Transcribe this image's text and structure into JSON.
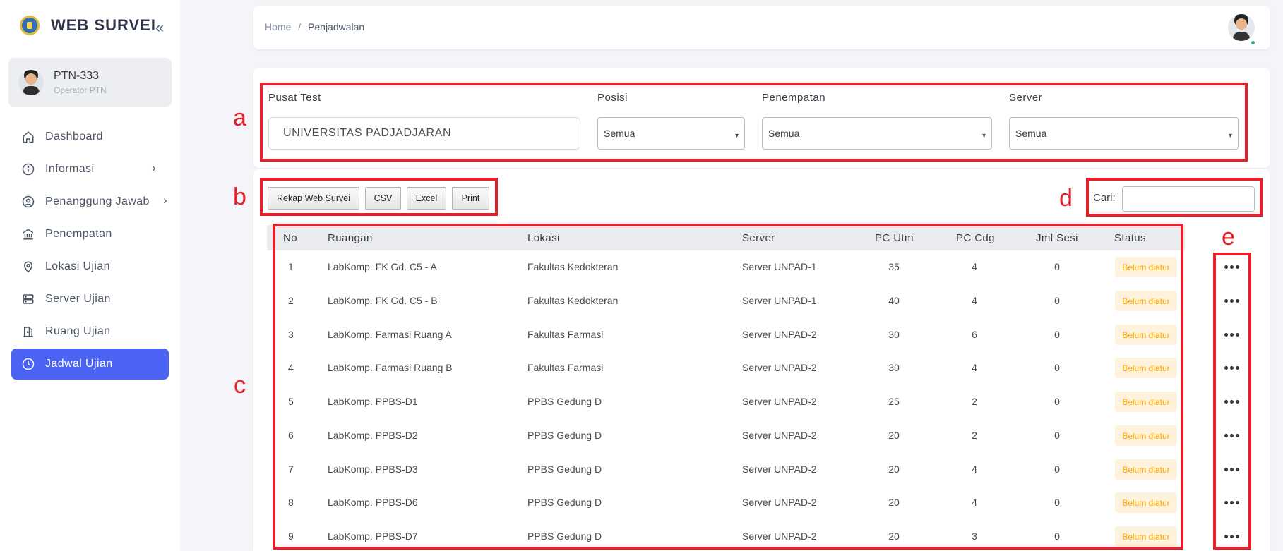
{
  "sidebar": {
    "brand_title": "WEB SURVEI",
    "user": {
      "name": "PTN-333",
      "role": "Operator PTN"
    },
    "items": [
      {
        "label": "Dashboard",
        "icon": "home-icon"
      },
      {
        "label": "Informasi",
        "icon": "info-icon",
        "has_children": true
      },
      {
        "label": "Penanggung Jawab",
        "icon": "user-circle-icon",
        "has_children": true
      },
      {
        "label": "Penempatan",
        "icon": "bank-icon"
      },
      {
        "label": "Lokasi Ujian",
        "icon": "map-pin-icon"
      },
      {
        "label": "Server Ujian",
        "icon": "server-icon"
      },
      {
        "label": "Ruang Ujian",
        "icon": "door-icon"
      },
      {
        "label": "Jadwal Ujian",
        "icon": "clock-icon",
        "active": true
      }
    ],
    "accent_color": "#4a63f2"
  },
  "header": {
    "breadcrumb_home": "Home",
    "breadcrumb_separator": "/",
    "breadcrumb_current": "Penjadwalan"
  },
  "filters": {
    "pusat_test": {
      "label": "Pusat Test",
      "value": "UNIVERSITAS PADJADJARAN"
    },
    "posisi": {
      "label": "Posisi",
      "value": "Semua"
    },
    "penempatan": {
      "label": "Penempatan",
      "value": "Semua"
    },
    "server": {
      "label": "Server",
      "value": "Semua"
    }
  },
  "toolbar": {
    "buttons": [
      "Rekap Web Survei",
      "CSV",
      "Excel",
      "Print"
    ],
    "search_label": "Cari:"
  },
  "table": {
    "headers": [
      "No",
      "Ruangan",
      "Lokasi",
      "Server",
      "PC Utm",
      "PC Cdg",
      "Jml Sesi",
      "Status"
    ],
    "rows": [
      {
        "no": "1",
        "ruangan": "LabKomp. FK Gd. C5 - A",
        "lokasi": "Fakultas Kedokteran",
        "server": "Server UNPAD-1",
        "pc_utm": "35",
        "pc_cdg": "4",
        "jml_sesi": "0",
        "status": "Belum diatur"
      },
      {
        "no": "2",
        "ruangan": "LabKomp. FK Gd. C5 - B",
        "lokasi": "Fakultas Kedokteran",
        "server": "Server UNPAD-1",
        "pc_utm": "40",
        "pc_cdg": "4",
        "jml_sesi": "0",
        "status": "Belum diatur"
      },
      {
        "no": "3",
        "ruangan": "LabKomp. Farmasi Ruang A",
        "lokasi": "Fakultas Farmasi",
        "server": "Server UNPAD-2",
        "pc_utm": "30",
        "pc_cdg": "6",
        "jml_sesi": "0",
        "status": "Belum diatur"
      },
      {
        "no": "4",
        "ruangan": "LabKomp. Farmasi Ruang B",
        "lokasi": "Fakultas Farmasi",
        "server": "Server UNPAD-2",
        "pc_utm": "30",
        "pc_cdg": "4",
        "jml_sesi": "0",
        "status": "Belum diatur"
      },
      {
        "no": "5",
        "ruangan": "LabKomp. PPBS-D1",
        "lokasi": "PPBS Gedung D",
        "server": "Server UNPAD-2",
        "pc_utm": "25",
        "pc_cdg": "2",
        "jml_sesi": "0",
        "status": "Belum diatur"
      },
      {
        "no": "6",
        "ruangan": "LabKomp. PPBS-D2",
        "lokasi": "PPBS Gedung D",
        "server": "Server UNPAD-2",
        "pc_utm": "20",
        "pc_cdg": "2",
        "jml_sesi": "0",
        "status": "Belum diatur"
      },
      {
        "no": "7",
        "ruangan": "LabKomp. PPBS-D3",
        "lokasi": "PPBS Gedung D",
        "server": "Server UNPAD-2",
        "pc_utm": "20",
        "pc_cdg": "4",
        "jml_sesi": "0",
        "status": "Belum diatur"
      },
      {
        "no": "8",
        "ruangan": "LabKomp. PPBS-D6",
        "lokasi": "PPBS Gedung D",
        "server": "Server UNPAD-2",
        "pc_utm": "20",
        "pc_cdg": "4",
        "jml_sesi": "0",
        "status": "Belum diatur"
      },
      {
        "no": "9",
        "ruangan": "LabKomp. PPBS-D7",
        "lokasi": "PPBS Gedung D",
        "server": "Server UNPAD-2",
        "pc_utm": "20",
        "pc_cdg": "3",
        "jml_sesi": "0",
        "status": "Belum diatur"
      }
    ],
    "status_color": "#ffab00",
    "action_icon": "more-horizontal-icon"
  },
  "annotations": [
    "a",
    "b",
    "c",
    "d",
    "e"
  ],
  "annotation_color": "#e6202a"
}
